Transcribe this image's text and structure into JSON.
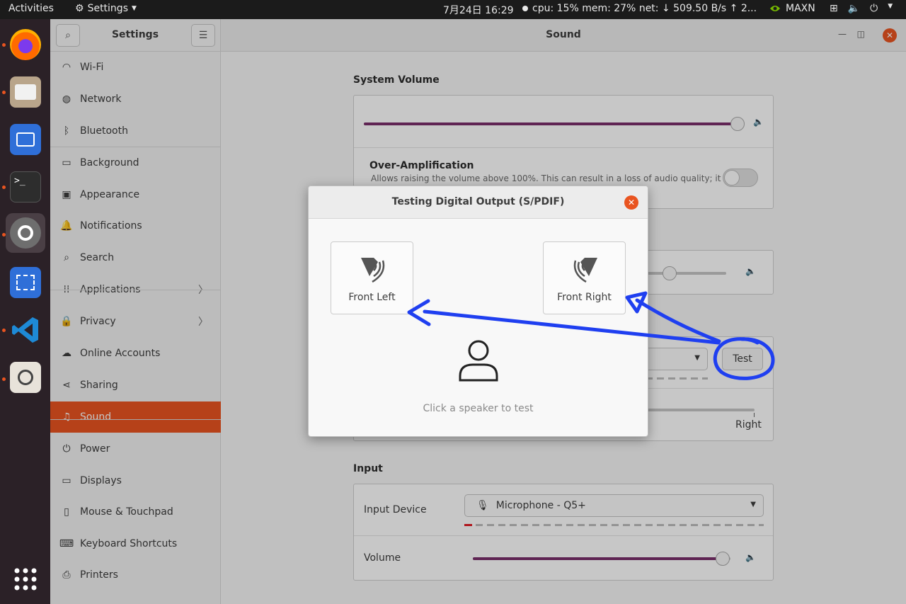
{
  "topbar": {
    "activities": "Activities",
    "app_menu": "Settings",
    "clock": "7月24日  16:29",
    "sysmon": "cpu: 15% mem: 27% net: ↓   509.50 B/s ↑   2...",
    "nvidia": "MAXN"
  },
  "dock": {
    "items": [
      "Firefox",
      "Files",
      "Remmina",
      "Terminal",
      "Settings",
      "Screenshot",
      "Visual Studio Code",
      "Image Viewer"
    ]
  },
  "sidebar": {
    "title": "Settings",
    "items": [
      {
        "label": "Wi-Fi",
        "icon": "wifi-icon"
      },
      {
        "label": "Network",
        "icon": "network-icon"
      },
      {
        "label": "Bluetooth",
        "icon": "bluetooth-icon"
      },
      {
        "label": "Background",
        "icon": "background-icon"
      },
      {
        "label": "Appearance",
        "icon": "appearance-icon"
      },
      {
        "label": "Notifications",
        "icon": "bell-icon"
      },
      {
        "label": "Search",
        "icon": "search-icon"
      },
      {
        "label": "Applications",
        "icon": "grid-icon"
      },
      {
        "label": "Privacy",
        "icon": "lock-icon"
      },
      {
        "label": "Online Accounts",
        "icon": "cloud-icon"
      },
      {
        "label": "Sharing",
        "icon": "share-icon"
      },
      {
        "label": "Sound",
        "icon": "music-note-icon"
      },
      {
        "label": "Power",
        "icon": "power-icon"
      },
      {
        "label": "Displays",
        "icon": "display-icon"
      },
      {
        "label": "Mouse & Touchpad",
        "icon": "mouse-icon"
      },
      {
        "label": "Keyboard Shortcuts",
        "icon": "keyboard-icon"
      },
      {
        "label": "Printers",
        "icon": "printer-icon"
      }
    ]
  },
  "main": {
    "title": "Sound",
    "system_volume": {
      "title": "System Volume",
      "level": 1.0,
      "over_amp_title": "Over-Amplification",
      "over_amp_desc": "Allows raising the volume above 100%. This can result in a loss of audio quality; it",
      "over_amp_enabled": false
    },
    "output": {
      "volume_level": 0.85,
      "test_button": "Test",
      "balance_right": "Right"
    },
    "input": {
      "title": "Input",
      "device_label": "Input Device",
      "device_value": "Microphone - Q5+",
      "volume_label": "Volume",
      "volume_level": 0.97
    }
  },
  "dialog": {
    "title": "Testing Digital Output (S/PDIF)",
    "front_left": "Front Left",
    "front_right": "Front Right",
    "hint": "Click a speaker to test"
  },
  "colors": {
    "accent": "#e95420",
    "slider": "#7a2f6b",
    "annotation": "#1f3ff0"
  }
}
